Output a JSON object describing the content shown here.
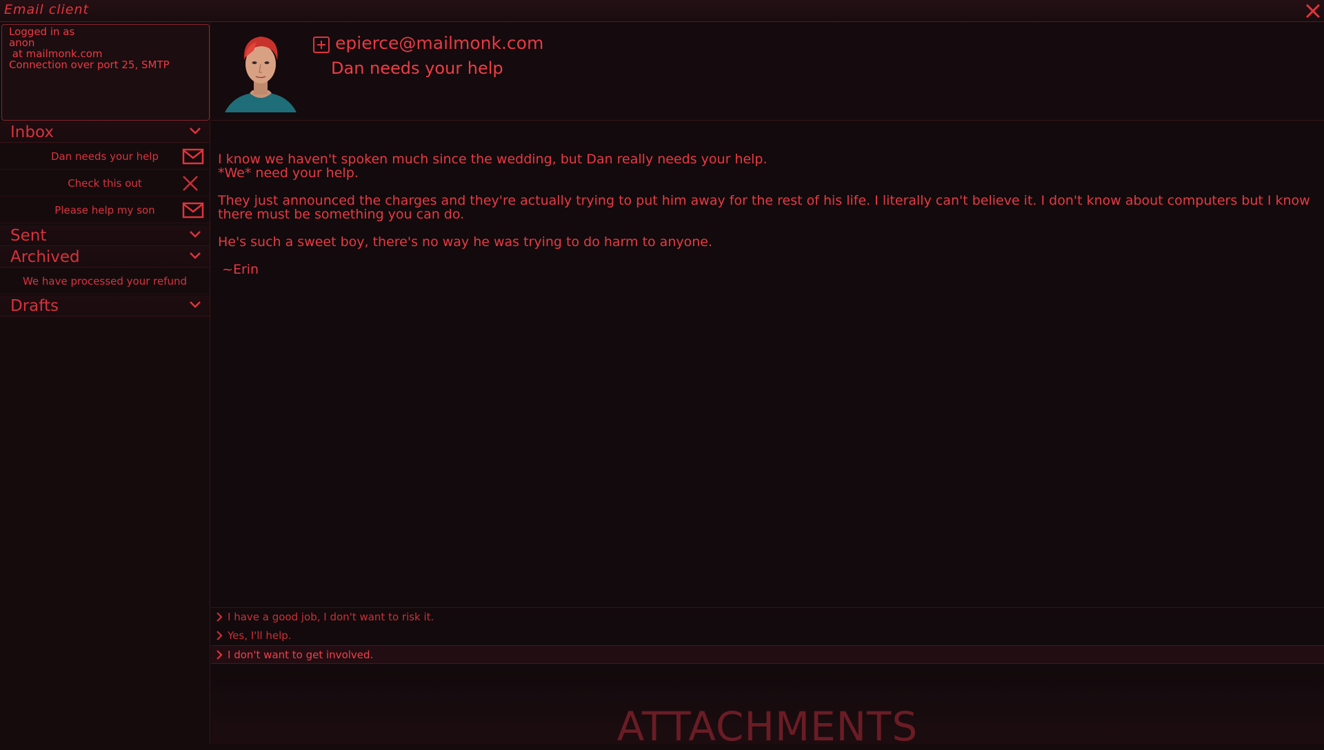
{
  "window": {
    "title": "Email client"
  },
  "login": {
    "lines": [
      "Logged in as",
      "anon",
      " at mailmonk.com",
      "Connection over port 25, SMTP"
    ]
  },
  "folders": {
    "inbox": {
      "label": "Inbox",
      "items": [
        {
          "label": "Dan needs your help",
          "icon": "envelope-icon"
        },
        {
          "label": "Check this out",
          "icon": "close-icon"
        },
        {
          "label": "Please help my son",
          "icon": "envelope-icon"
        }
      ]
    },
    "sent": {
      "label": "Sent"
    },
    "archived": {
      "label": "Archived",
      "items": [
        {
          "label": "We have processed your refund"
        }
      ]
    },
    "drafts": {
      "label": "Drafts"
    }
  },
  "message": {
    "sender": "epierce@mailmonk.com",
    "subject": "Dan needs your help",
    "body": [
      "I know we haven't spoken much since the wedding, but Dan really needs your help.",
      "*We* need your help.",
      "They just announced the charges and they're actually trying to put him away for the rest of his life. I literally can't believe it. I don't know about computers but I know there must be something you can do.",
      "He's such a sweet boy, there's no way he was trying to do harm to anyone.",
      " ~Erin"
    ]
  },
  "replies": [
    {
      "label": "I have a good job, I don't want to risk it."
    },
    {
      "label": "Yes, I'll help."
    },
    {
      "label": "I don't want to get involved."
    }
  ],
  "attachments": {
    "title": "ATTACHMENTS"
  },
  "colors": {
    "accent": "#e0303a",
    "background": "#120a0c",
    "border": "#5a1a20"
  }
}
